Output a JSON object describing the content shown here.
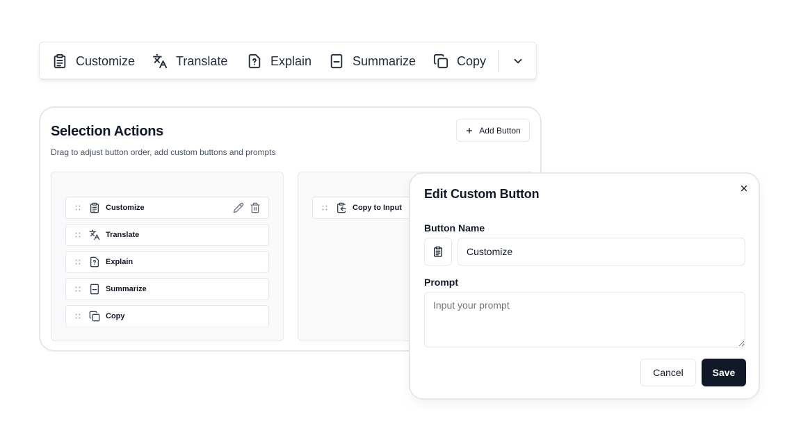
{
  "toolbar": {
    "buttons": [
      {
        "label": "Customize",
        "icon": "clipboard-list-icon"
      },
      {
        "label": "Translate",
        "icon": "languages-icon"
      },
      {
        "label": "Explain",
        "icon": "file-question-icon"
      },
      {
        "label": "Summarize",
        "icon": "notebook-icon"
      },
      {
        "label": "Copy",
        "icon": "copy-icon"
      }
    ],
    "more_icon": "chevron-down-icon"
  },
  "settings": {
    "title": "Selection Actions",
    "description": "Drag to adjust button order, add custom buttons and prompts",
    "add_button_label": "Add Button",
    "enabled_items": [
      {
        "label": "Customize",
        "icon": "clipboard-list-icon"
      },
      {
        "label": "Translate",
        "icon": "languages-icon"
      },
      {
        "label": "Explain",
        "icon": "file-question-icon"
      },
      {
        "label": "Summarize",
        "icon": "notebook-icon"
      },
      {
        "label": "Copy",
        "icon": "copy-icon"
      }
    ],
    "disabled_items": [
      {
        "label": "Copy to Input",
        "icon": "clipboard-arrow-icon"
      }
    ]
  },
  "dialog": {
    "title": "Edit Custom Button",
    "name_label": "Button Name",
    "name_value": "Customize",
    "prompt_label": "Prompt",
    "prompt_placeholder": "Input your prompt",
    "cancel_label": "Cancel",
    "save_label": "Save"
  },
  "colors": {
    "primary_dark": "#111827",
    "border": "#e5e7eb",
    "muted_text": "#4b5563",
    "panel_bg": "#f9fafb"
  }
}
